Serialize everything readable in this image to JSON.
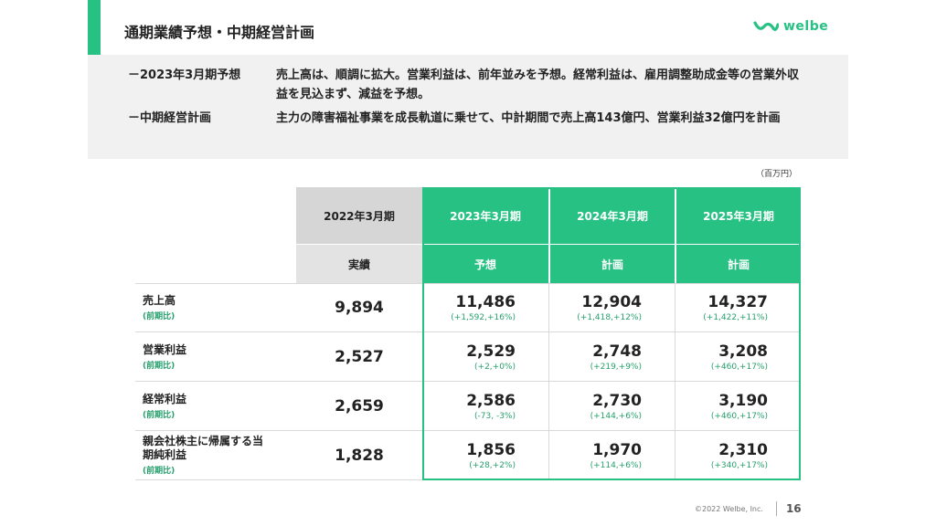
{
  "page": {
    "title": "通期業績予想・中期経営計画",
    "logo_text": "welbe",
    "brand_color": "#27c283"
  },
  "summary": [
    {
      "label": "－2023年3月期予想",
      "text": "売上高は、順調に拡大。営業利益は、前年並みを予想。経常利益は、雇用調整助成金等の営業外収益を見込まず、減益を予想。"
    },
    {
      "label": "－中期経営計画",
      "text": "主力の障害福祉事業を成長軌道に乗せて、中計期間で売上高143億円、営業利益32億円を計画"
    }
  ],
  "unit": "（百万円）",
  "table": {
    "columns": [
      {
        "period": "2022年3月期",
        "type": "実績"
      },
      {
        "period": "2023年3月期",
        "type": "予想"
      },
      {
        "period": "2024年3月期",
        "type": "計画"
      },
      {
        "period": "2025年3月期",
        "type": "計画"
      }
    ],
    "sub_label": "(前期比)",
    "rows": [
      {
        "name": "売上高",
        "actual": "9,894",
        "proj": [
          {
            "v": "11,486",
            "c": "(+1,592,+16%)"
          },
          {
            "v": "12,904",
            "c": "(+1,418,+12%)"
          },
          {
            "v": "14,327",
            "c": "(+1,422,+11%)"
          }
        ]
      },
      {
        "name": "営業利益",
        "actual": "2,527",
        "proj": [
          {
            "v": "2,529",
            "c": "(+2,+0%)"
          },
          {
            "v": "2,748",
            "c": "(+219,+9%)"
          },
          {
            "v": "3,208",
            "c": "(+460,+17%)"
          }
        ]
      },
      {
        "name": "経常利益",
        "actual": "2,659",
        "proj": [
          {
            "v": "2,586",
            "c": "(-73, -3%)"
          },
          {
            "v": "2,730",
            "c": "(+144,+6%)"
          },
          {
            "v": "3,190",
            "c": "(+460,+17%)"
          }
        ]
      },
      {
        "name": "親会社株主に帰属する当期純利益",
        "actual": "1,828",
        "proj": [
          {
            "v": "1,856",
            "c": "(+28,+2%)"
          },
          {
            "v": "1,970",
            "c": "(+114,+6%)"
          },
          {
            "v": "2,310",
            "c": "(+340,+17%)"
          }
        ]
      }
    ]
  },
  "footer": {
    "copyright": "©2022 Welbe, Inc.",
    "page_number": "16"
  }
}
